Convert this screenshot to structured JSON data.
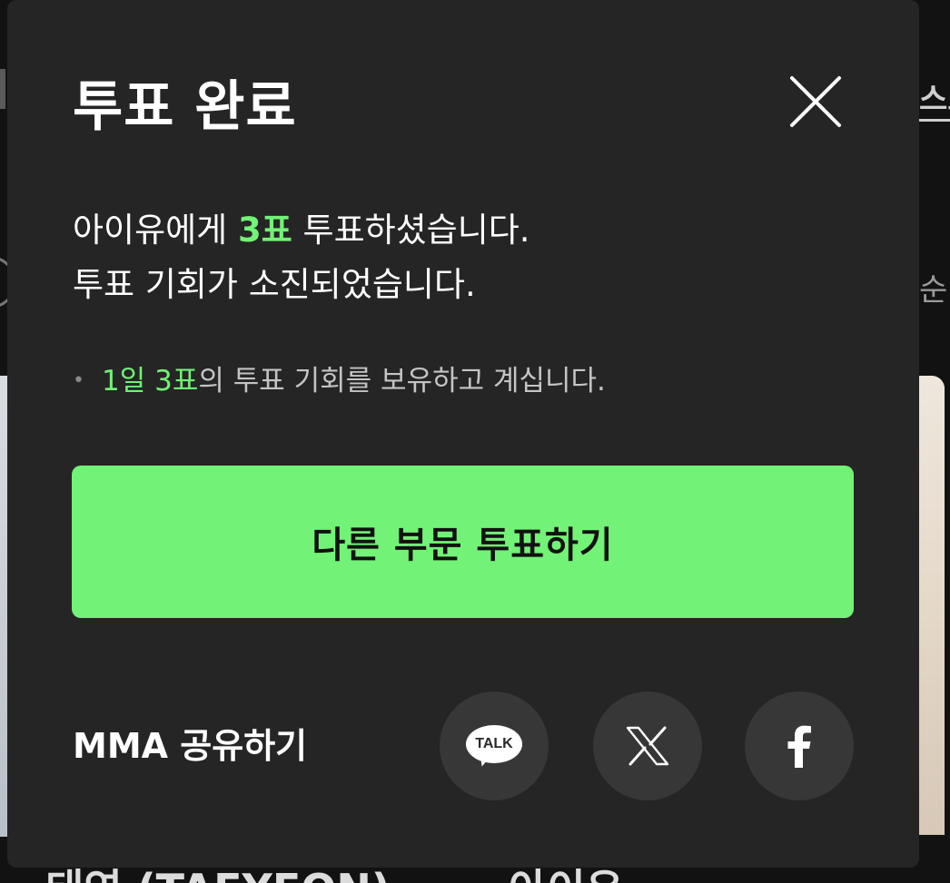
{
  "background": {
    "right_header_fragment": "스트",
    "right_sort_fragment": "순",
    "bottom_left_fragment": "태연 (TAEYEON)",
    "bottom_right_fragment": "아이유"
  },
  "modal": {
    "title": "투표 완료",
    "close_icon": "close-icon",
    "message": {
      "line1_prefix": "아이유에게 ",
      "line1_highlight": "3표",
      "line1_suffix": " 투표하셨습니다.",
      "line2": "투표 기회가 소진되었습니다."
    },
    "note": {
      "bullet": "•",
      "highlight": "1일 3표",
      "suffix": "의 투표 기회를 보유하고 계십니다."
    },
    "primary_button_label": "다른 부문 투표하기",
    "share": {
      "label": "MMA 공유하기",
      "kakao_text": "TALK",
      "kakao_icon": "kakaotalk-icon",
      "x_icon": "x-twitter-icon",
      "facebook_icon": "facebook-icon"
    }
  },
  "colors": {
    "modal_background": "#252525",
    "accent": "#72f276",
    "share_button_background": "#373737",
    "text_primary": "#ffffff",
    "text_secondary": "#c4c4c4"
  }
}
